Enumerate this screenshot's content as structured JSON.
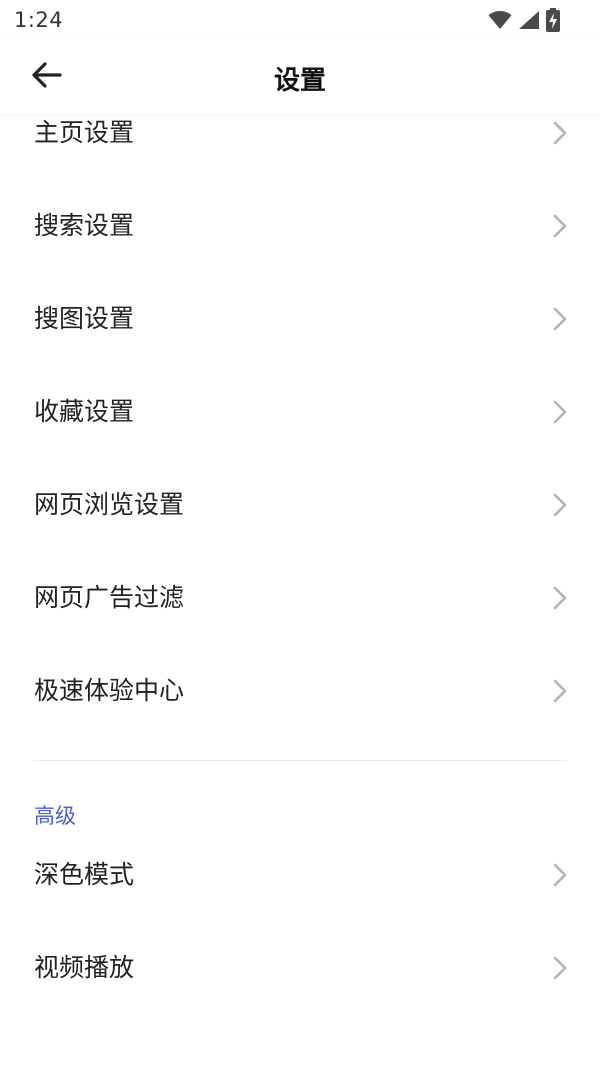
{
  "status_bar": {
    "time": "1:24",
    "icons": [
      "wifi-icon",
      "signal-icon",
      "battery-charging-icon"
    ]
  },
  "app_bar": {
    "title": "设置",
    "back_icon": "arrow-left-icon"
  },
  "settings": {
    "items": [
      {
        "label": "主页设置"
      },
      {
        "label": "搜索设置"
      },
      {
        "label": "搜图设置"
      },
      {
        "label": "收藏设置"
      },
      {
        "label": "网页浏览设置"
      },
      {
        "label": "网页广告过滤"
      },
      {
        "label": "极速体验中心"
      }
    ]
  },
  "advanced": {
    "title": "高级",
    "items": [
      {
        "label": "深色模式"
      },
      {
        "label": "视频播放"
      }
    ]
  },
  "colors": {
    "accent": "#4a5fd8",
    "chevron": "#b3b3b3",
    "text": "#222222"
  }
}
